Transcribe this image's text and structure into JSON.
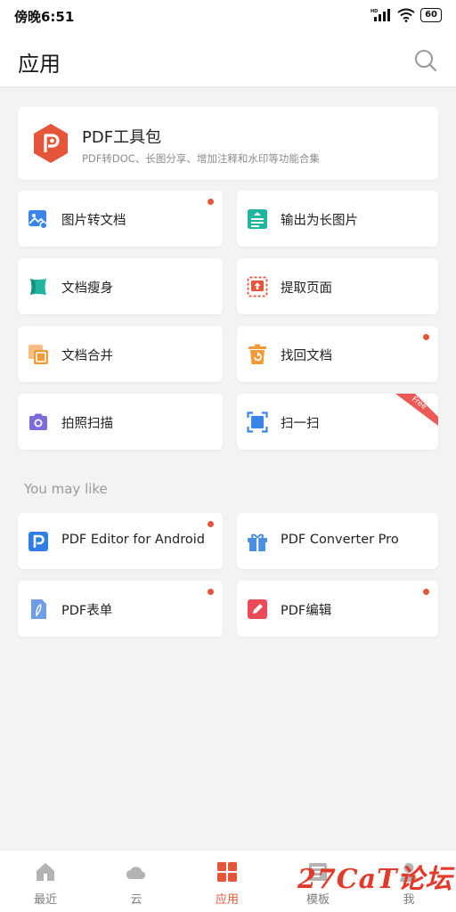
{
  "status": {
    "time": "傍晚6:51",
    "network": "HD",
    "battery": "60"
  },
  "header": {
    "title": "应用"
  },
  "toolkit": {
    "title": "PDF工具包",
    "subtitle": "PDF转DOC、长图分享、增加注释和水印等功能合集"
  },
  "tools": [
    {
      "label": "图片转文档",
      "icon": "image-to-doc-icon",
      "color": "#3a86e8",
      "dot": true
    },
    {
      "label": "输出为长图片",
      "icon": "long-image-icon",
      "color": "#1fb5a0",
      "dot": false
    },
    {
      "label": "文档瘦身",
      "icon": "slim-doc-icon",
      "color": "#1fb5a0",
      "dot": false
    },
    {
      "label": "提取页面",
      "icon": "extract-page-icon",
      "color": "#e5553a",
      "dot": false
    },
    {
      "label": "文档合并",
      "icon": "merge-doc-icon",
      "color": "#f29a38",
      "dot": false
    },
    {
      "label": "找回文档",
      "icon": "recover-doc-icon",
      "color": "#f29a38",
      "dot": true
    },
    {
      "label": "拍照扫描",
      "icon": "camera-icon",
      "color": "#7d6bde",
      "dot": false
    },
    {
      "label": "扫一扫",
      "icon": "scan-icon",
      "color": "#3a86e8",
      "dot": false,
      "badge": "Free"
    }
  ],
  "recommend": {
    "heading": "You may like",
    "items": [
      {
        "label": "PDF Editor for Android",
        "icon": "pdf-editor-icon",
        "color": "#2f7ee6",
        "dot": true
      },
      {
        "label": "PDF Converter Pro",
        "icon": "gift-icon",
        "color": "#4a8fe0",
        "dot": false
      },
      {
        "label": "PDF表单",
        "icon": "pdf-form-icon",
        "color": "#6f9ee8",
        "dot": true
      },
      {
        "label": "PDF编辑",
        "icon": "pdf-edit-icon",
        "color": "#ea4b57",
        "dot": true
      }
    ]
  },
  "tabs": [
    {
      "label": "最近",
      "icon": "home-icon",
      "active": false
    },
    {
      "label": "云",
      "icon": "cloud-icon",
      "active": false
    },
    {
      "label": "应用",
      "icon": "apps-icon",
      "active": true
    },
    {
      "label": "模板",
      "icon": "template-icon",
      "active": false
    },
    {
      "label": "我",
      "icon": "profile-icon",
      "active": false
    }
  ],
  "colors": {
    "accent": "#e5553a",
    "background": "#f3f3f3"
  },
  "watermark": "27CaT论坛"
}
